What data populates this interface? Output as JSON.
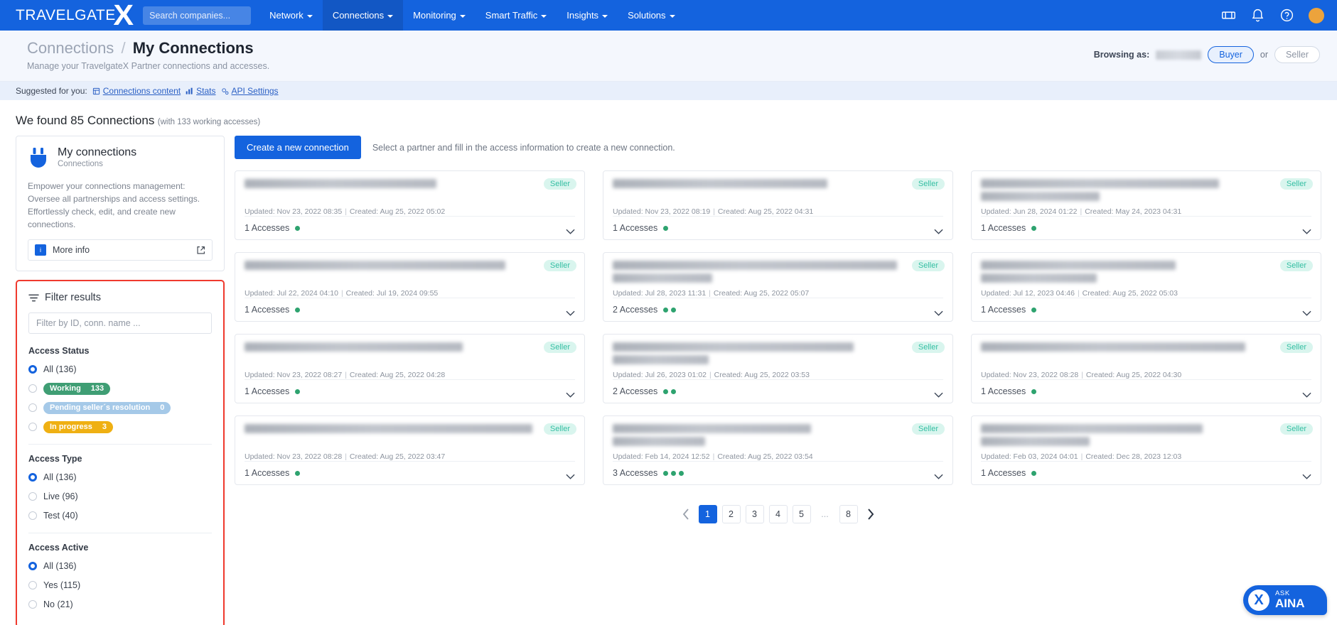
{
  "topnav": {
    "brand_text": "TRAVELGATE",
    "brand_mark": "X",
    "search_placeholder": "Search companies...",
    "items": [
      {
        "label": "Network",
        "active": false
      },
      {
        "label": "Connections",
        "active": true
      },
      {
        "label": "Monitoring",
        "active": false
      },
      {
        "label": "Smart Traffic",
        "active": false
      },
      {
        "label": "Insights",
        "active": false
      },
      {
        "label": "Solutions",
        "active": false
      }
    ],
    "icons": [
      "ticket-icon",
      "bell-icon",
      "help-icon",
      "avatar"
    ],
    "accent": "#1463de"
  },
  "header": {
    "breadcrumb_parent": "Connections",
    "breadcrumb_sep": "/",
    "breadcrumb_current": "My Connections",
    "subtitle": "Manage your TravelgateX Partner connections and accesses.",
    "browsing_label": "Browsing as:",
    "role_buyer": "Buyer",
    "role_or": "or",
    "role_seller": "Seller",
    "selected_role": "Buyer"
  },
  "suggested": {
    "label": "Suggested for you:",
    "links": [
      {
        "text": "Connections content",
        "icon": "content-icon"
      },
      {
        "text": "Stats",
        "icon": "chart-icon"
      },
      {
        "text": "API Settings",
        "icon": "gear-icon"
      }
    ]
  },
  "results": {
    "title": "We found 85 Connections",
    "subtitle": "(with 133 working accesses)"
  },
  "info_card": {
    "icon": "plug-icon",
    "title": "My connections",
    "kicker": "Connections",
    "description": "Empower your connections management: Oversee all partnerships and access settings. Effortlessly check, edit, and create new connections.",
    "more_info_label": "More info",
    "more_info_icon": "external-link-icon"
  },
  "filters": {
    "title": "Filter results",
    "icon": "filter-icon",
    "search_placeholder": "Filter by ID, conn. name ...",
    "groups": [
      {
        "title": "Access Status",
        "options": [
          {
            "label": "All (136)",
            "selected": true,
            "badge": null
          },
          {
            "label": "Working",
            "selected": false,
            "badge": {
              "text": "Working",
              "count": "133",
              "color": "green"
            }
          },
          {
            "label": "Pending seller´s resolution",
            "selected": false,
            "badge": {
              "text": "Pending seller´s resolution",
              "count": "0",
              "color": "blue"
            }
          },
          {
            "label": "In progress",
            "selected": false,
            "badge": {
              "text": "In progress",
              "count": "3",
              "color": "amber"
            }
          }
        ]
      },
      {
        "title": "Access Type",
        "options": [
          {
            "label": "All (136)",
            "selected": true,
            "badge": null
          },
          {
            "label": "Live (96)",
            "selected": false,
            "badge": null
          },
          {
            "label": "Test (40)",
            "selected": false,
            "badge": null
          }
        ]
      },
      {
        "title": "Access Active",
        "options": [
          {
            "label": "All (136)",
            "selected": true,
            "badge": null
          },
          {
            "label": "Yes (115)",
            "selected": false,
            "badge": null
          },
          {
            "label": "No (21)",
            "selected": false,
            "badge": null
          }
        ]
      }
    ],
    "highlight_color": "#f03a2e"
  },
  "main": {
    "create_button": "Create a new connection",
    "create_hint": "Select a partner and fill in the access information to create a new connection.",
    "tag_seller": "Seller",
    "cards": [
      {
        "name_redacted": true,
        "name_lines": 1,
        "updated": "Updated: Nov 23, 2022 08:35",
        "created": "Created: Aug 25, 2022 05:02",
        "accesses": "1 Accesses",
        "dots": 1,
        "tag": "Seller"
      },
      {
        "name_redacted": true,
        "name_lines": 1,
        "updated": "Updated: Nov 23, 2022 08:19",
        "created": "Created: Aug 25, 2022 04:31",
        "accesses": "1 Accesses",
        "dots": 1,
        "tag": "Seller"
      },
      {
        "name_redacted": true,
        "name_lines": 2,
        "updated": "Updated: Jun 28, 2024 01:22",
        "created": "Created: May 24, 2023 04:31",
        "accesses": "1 Accesses",
        "dots": 1,
        "tag": "Seller"
      },
      {
        "name_redacted": true,
        "name_lines": 1,
        "updated": "Updated: Jul 22, 2024 04:10",
        "created": "Created: Jul 19, 2024 09:55",
        "accesses": "1 Accesses",
        "dots": 1,
        "tag": "Seller"
      },
      {
        "name_redacted": true,
        "name_lines": 2,
        "updated": "Updated: Jul 28, 2023 11:31",
        "created": "Created: Aug 25, 2022 05:07",
        "accesses": "2 Accesses",
        "dots": 2,
        "tag": "Seller"
      },
      {
        "name_redacted": true,
        "name_lines": 2,
        "updated": "Updated: Jul 12, 2023 04:46",
        "created": "Created: Aug 25, 2022 05:03",
        "accesses": "1 Accesses",
        "dots": 1,
        "tag": "Seller"
      },
      {
        "name_redacted": true,
        "name_lines": 1,
        "updated": "Updated: Nov 23, 2022 08:27",
        "created": "Created: Aug 25, 2022 04:28",
        "accesses": "1 Accesses",
        "dots": 1,
        "tag": "Seller"
      },
      {
        "name_redacted": true,
        "name_lines": 2,
        "updated": "Updated: Jul 26, 2023 01:02",
        "created": "Created: Aug 25, 2022 03:53",
        "accesses": "2 Accesses",
        "dots": 2,
        "tag": "Seller"
      },
      {
        "name_redacted": true,
        "name_lines": 1,
        "updated": "Updated: Nov 23, 2022 08:28",
        "created": "Created: Aug 25, 2022 04:30",
        "accesses": "1 Accesses",
        "dots": 1,
        "tag": "Seller"
      },
      {
        "name_redacted": true,
        "name_lines": 1,
        "updated": "Updated: Nov 23, 2022 08:28",
        "created": "Created: Aug 25, 2022 03:47",
        "accesses": "1 Accesses",
        "dots": 1,
        "tag": "Seller"
      },
      {
        "name_redacted": true,
        "name_lines": 2,
        "updated": "Updated: Feb 14, 2024 12:52",
        "created": "Created: Aug 25, 2022 03:54",
        "accesses": "3 Accesses",
        "dots": 3,
        "tag": "Seller"
      },
      {
        "name_redacted": true,
        "name_lines": 2,
        "updated": "Updated: Feb 03, 2024 04:01",
        "created": "Created: Dec 28, 2023 12:03",
        "accesses": "1 Accesses",
        "dots": 1,
        "tag": "Seller"
      }
    ]
  },
  "pagination": {
    "prev_icon": "chevron-left-icon",
    "next_icon": "chevron-right-icon",
    "pages": [
      "1",
      "2",
      "3",
      "4",
      "5",
      "...",
      "8"
    ],
    "current": "1"
  },
  "aina": {
    "mark": "X",
    "ask": "ASK",
    "name": "AINA"
  }
}
